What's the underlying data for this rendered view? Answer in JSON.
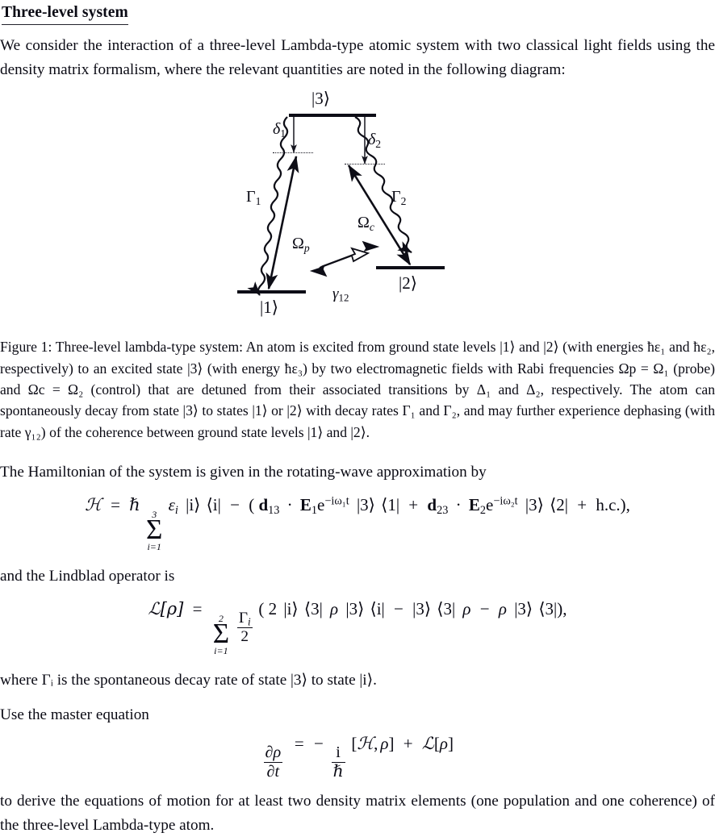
{
  "document": {
    "title": "Three-level system",
    "intro": "We consider the interaction of a three-level Lambda-type atomic system with two classical light fields using the density matrix formalism, where the relevant quantities are noted in the following diagram:"
  },
  "figure": {
    "diagram_name": "three-level-lambda-system",
    "levels": [
      {
        "id": "level-3",
        "label": "|3⟩",
        "name": "excited-state"
      },
      {
        "id": "level-1",
        "label": "|1⟩",
        "name": "ground-state-1"
      },
      {
        "id": "level-2",
        "label": "|2⟩",
        "name": "ground-state-2"
      }
    ],
    "detunings": [
      {
        "id": "delta-1",
        "label_base": "δ",
        "label_sub": "1"
      },
      {
        "id": "delta-2",
        "label_base": "δ",
        "label_sub": "2"
      }
    ],
    "decay_rates": [
      {
        "id": "gamma-capital-1",
        "label_base": "Γ",
        "label_sub": "1"
      },
      {
        "id": "gamma-capital-2",
        "label_base": "Γ",
        "label_sub": "2"
      }
    ],
    "rabi_frequencies": [
      {
        "id": "omega-p",
        "label_base": "Ω",
        "label_sub": "p",
        "role": "probe"
      },
      {
        "id": "omega-c",
        "label_base": "Ω",
        "label_sub": "c",
        "role": "control"
      }
    ],
    "dephasing": {
      "id": "gamma-12",
      "label_base": "γ",
      "label_sub": "12"
    },
    "caption": "Figure 1: Three-level lambda-type system: An atom is excited from ground state levels |1⟩ and |2⟩ (with energies ħε₁ and ħε₂, respectively) to an excited state |3⟩ (with energy ħε₃) by two electromagnetic fields with Rabi frequencies Ωp = Ω₁ (probe) and Ωc = Ω₂ (control) that are detuned from their associated transitions by Δ₁ and Δ₂, respectively. The atom can spontaneously decay from state |3⟩ to states |1⟩ or |2⟩ with decay rates Γ₁ and Γ₂, and may further experience dephasing (with rate γ₁₂) of the coherence between ground state levels |1⟩ and |2⟩."
  },
  "sections": {
    "hamiltonian_lead": "The Hamiltonian of the system is given in the rotating-wave approximation by",
    "lindblad_lead": "and the Lindblad operator is",
    "gamma_note": "where Γᵢ is the spontaneous decay rate of state |3⟩ to state |i⟩.",
    "master_lead": "Use the master equation",
    "task": "to derive the equations of motion for at least two density matrix elements (one population and one coherence) of the three-level Lambda-type atom."
  },
  "equations": {
    "hamiltonian": {
      "id": "eq-hamiltonian",
      "plain": "ℋ = ℏ Σ_{i=1}^{3} ε_i |i⟩⟨i| − (d₁₃ · E₁ e^{−iω₁t} |3⟩⟨1| + d₂₃ · E₂ e^{−iω₂t} |3⟩⟨2| + h.c.),",
      "parts": {
        "lhs": "ℋ",
        "equals": "=",
        "hbar": "ℏ",
        "sum_top": "3",
        "sum_bottom": "i=1",
        "sigma": "Σ",
        "eps": "ε",
        "eps_sub": "i",
        "ket_i": "|i⟩",
        "bra_i": "⟨i|",
        "minus": "−",
        "open_paren": "(",
        "d13": "d",
        "d13_sub": "13",
        "dot": "·",
        "E1": "E",
        "E1_sub": "1",
        "exp_e": "e",
        "exp1": "−iω₁t",
        "ket3": "|3⟩",
        "bra1": "⟨1|",
        "plus": "+",
        "d23": "d",
        "d23_sub": "23",
        "E2": "E",
        "E2_sub": "2",
        "exp2": "−iω₂t",
        "bra2": "⟨2|",
        "hc": "h.c.",
        "close_paren": ")",
        "comma": ","
      }
    },
    "lindblad": {
      "id": "eq-lindblad",
      "plain": "𝓛[ρ] = Σ_{i=1}^{2} (Γ_i/2)(2|i⟩⟨3| ρ |3⟩⟨i| − |3⟩⟨3| ρ − ρ |3⟩⟨3|),",
      "parts": {
        "lhs": "ℒ[ρ]",
        "equals": "=",
        "sum_top": "2",
        "sum_bottom": "i=1",
        "sigma": "Σ",
        "gamma": "Γ",
        "gamma_sub": "i",
        "two_den": "2",
        "open_paren": "(",
        "two": "2",
        "ket_i": "|i⟩",
        "bra3": "⟨3|",
        "rho": "ρ",
        "ket3": "|3⟩",
        "bra_i": "⟨i|",
        "minus": "−",
        "close_paren": ")",
        "comma": ","
      }
    },
    "master": {
      "id": "eq-master",
      "plain": "∂ρ/∂t = −(i/ℏ)[ℋ, ρ] + ℒ[ρ]",
      "parts": {
        "partial": "∂",
        "rho": "ρ",
        "t": "t",
        "equals": "=",
        "minus": "−",
        "i": "i",
        "hbar": "ℏ",
        "bracket_open": "[",
        "H": "ℋ",
        "comma": ",",
        "bracket_close": "]",
        "plus": "+",
        "L": "ℒ",
        "sq_open": "[",
        "sq_close": "]"
      }
    }
  },
  "colors": {
    "ink": "#0a0a14",
    "rule": "#22222c",
    "diagram": "#0d0d16",
    "page": "#ffffff"
  }
}
